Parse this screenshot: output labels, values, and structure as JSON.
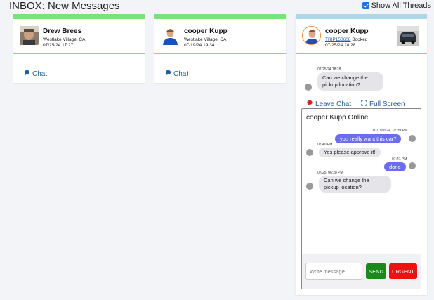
{
  "page": {
    "title": "INBOX: New Messages",
    "show_all_label": "Show All Threads"
  },
  "threads": [
    {
      "name": "Drew Brees",
      "location": "Westlake Village, CA",
      "date": "07/25/24 17:27",
      "chat_label": "Chat"
    },
    {
      "name": "cooper Kupp",
      "location": "Westlake Village, CA",
      "date": "07/19/24 19:34",
      "chat_label": "Chat"
    },
    {
      "name": "cooper Kupp",
      "trip_id": "TRIP150608",
      "trip_status": "Booked",
      "date": "07/25/24 18:28"
    }
  ],
  "preview": {
    "timestamp": "07/25/24 18:28",
    "text_line1": "Can we change the",
    "text_line2": "pickup location?"
  },
  "actions": {
    "leave_chat": "Leave Chat",
    "full_screen": "Full Screen"
  },
  "chat_panel": {
    "title": "cooper Kupp Online",
    "messages": [
      {
        "timestamp": "07/19/2024, 07:39 PM",
        "text": "you really want this car?",
        "direction": "out"
      },
      {
        "timestamp": "07:40 PM",
        "text": "Yes please approve it!",
        "direction": "in"
      },
      {
        "timestamp": "07:41 PM",
        "text": "done",
        "direction": "out"
      },
      {
        "timestamp": "07/25, 06:28 PM",
        "text_line1": "Can we change the",
        "text_line2": "pickup location?",
        "direction": "in"
      }
    ],
    "input_placeholder": "Write message",
    "send_label": "SEND",
    "urgent_label": "URGENT"
  },
  "colors": {
    "accent_green": "#7ee07a",
    "accent_blue": "#add8e6",
    "send": "#1a8a1a",
    "urgent": "#ee1111",
    "outgoing": "#6c6cf0",
    "link": "#1e5fa5"
  },
  "icons": [
    "checkbox-icon",
    "chat-bubble-icon",
    "leave-chat-icon",
    "fullscreen-icon"
  ]
}
